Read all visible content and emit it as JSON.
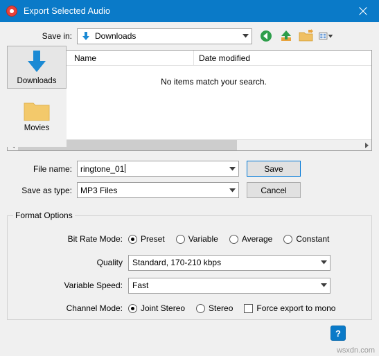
{
  "window": {
    "title": "Export Selected Audio",
    "icon": "audio-disc-icon",
    "close_label": "✕"
  },
  "savein": {
    "label": "Save in:",
    "value": "Downloads",
    "icon": "download-arrow-icon",
    "toolbar": [
      {
        "name": "back-button",
        "icon": "back-arrow-icon"
      },
      {
        "name": "up-one-level-button",
        "icon": "up-arrow-icon"
      },
      {
        "name": "new-folder-button",
        "icon": "new-folder-icon"
      },
      {
        "name": "view-menu-button",
        "icon": "views-icon"
      }
    ]
  },
  "places": [
    {
      "label": "Downloads",
      "icon": "download-arrow-icon",
      "selected": true
    },
    {
      "label": "Movies",
      "icon": "folder-icon",
      "selected": false
    }
  ],
  "filelist": {
    "columns": [
      "Name",
      "Date modified"
    ],
    "empty_message": "No items match your search.",
    "rows": []
  },
  "filename": {
    "label": "File name:",
    "value": "ringtone_01"
  },
  "filetype": {
    "label": "Save as type:",
    "value": "MP3 Files"
  },
  "buttons": {
    "save": "Save",
    "cancel": "Cancel"
  },
  "format_options": {
    "title": "Format Options",
    "bitrate": {
      "label": "Bit Rate Mode:",
      "options": [
        "Preset",
        "Variable",
        "Average",
        "Constant"
      ],
      "selected": "Preset"
    },
    "quality": {
      "label": "Quality",
      "value": "Standard, 170-210 kbps"
    },
    "variable_speed": {
      "label": "Variable Speed:",
      "value": "Fast"
    },
    "channel_mode": {
      "label": "Channel Mode:",
      "options": [
        "Joint Stereo",
        "Stereo"
      ],
      "selected": "Joint Stereo",
      "force_mono_label": "Force export to mono",
      "force_mono_checked": false
    }
  },
  "help": {
    "label": "?"
  },
  "watermark": "wsxdn.com",
  "colors": {
    "titlebar": "#0a7ac8",
    "accent": "#0078d7",
    "dialog_bg": "#f0f0f0"
  }
}
